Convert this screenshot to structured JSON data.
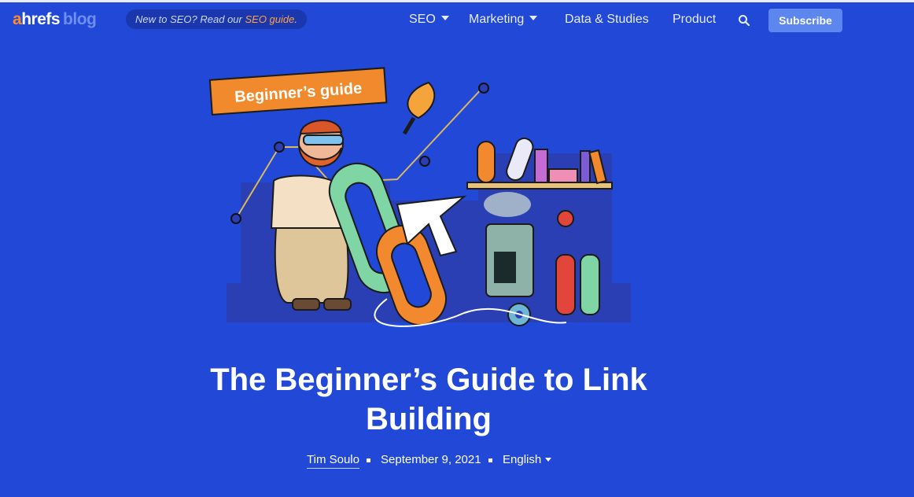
{
  "header": {
    "logo": {
      "a": "a",
      "hrefs": "hrefs",
      "blog": "blog"
    },
    "promo": {
      "text": "New to SEO? Read our ",
      "link": "SEO guide",
      "end": "."
    },
    "nav": [
      {
        "label": "SEO",
        "has_dropdown": true
      },
      {
        "label": "Marketing",
        "has_dropdown": true
      },
      {
        "label": "Data & Studies",
        "has_dropdown": false
      },
      {
        "label": "Product",
        "has_dropdown": false
      }
    ],
    "search_icon": "search-icon",
    "subscribe_label": "Subscribe"
  },
  "hero": {
    "badge_label": "Beginner’s guide"
  },
  "article": {
    "title_line1": "The Beginner’s Guide to Link",
    "title_line2": "Building",
    "author": "Tim Soulo",
    "date": "September 9, 2021",
    "language": "English"
  },
  "colors": {
    "background": "#2148d6",
    "accent_orange": "#ff8a2b",
    "subscribe_bg": "#5d86ee"
  }
}
